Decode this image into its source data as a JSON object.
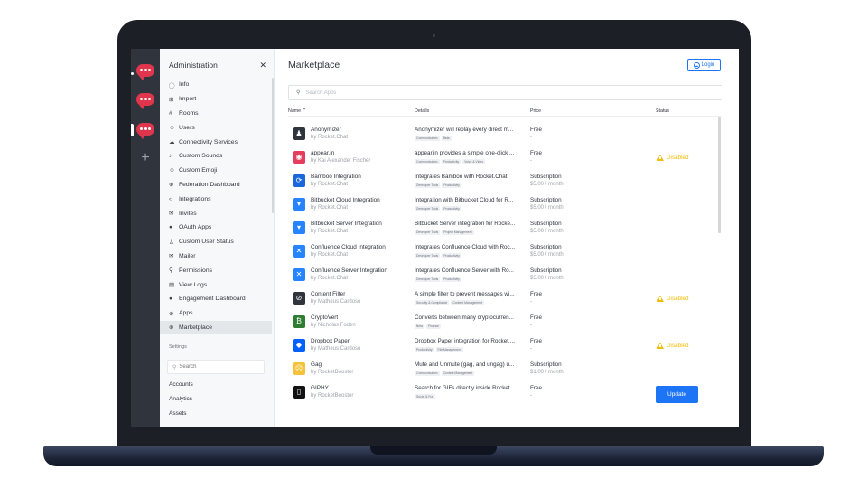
{
  "colors": {
    "accent": "#1d74f5",
    "server": "#e0364d",
    "warning": "#f3be08",
    "rail": "#2f343d",
    "bezel": "#1c1f26"
  },
  "rail": {
    "add_icon": "+"
  },
  "sidebar": {
    "title": "Administration",
    "close": "✕",
    "items": [
      {
        "icon": "ⓘ",
        "label": "Info"
      },
      {
        "icon": "⊞",
        "label": "Import"
      },
      {
        "icon": "#",
        "label": "Rooms"
      },
      {
        "icon": "☺",
        "label": "Users"
      },
      {
        "icon": "☁",
        "label": "Connectivity Services"
      },
      {
        "icon": "♪",
        "label": "Custom Sounds"
      },
      {
        "icon": "☺",
        "label": "Custom Emoji"
      },
      {
        "icon": "⊕",
        "label": "Federation Dashboard"
      },
      {
        "icon": "‹›",
        "label": "Integrations"
      },
      {
        "icon": "✉",
        "label": "Invites"
      },
      {
        "icon": "●",
        "label": "OAuth Apps"
      },
      {
        "icon": "♙",
        "label": "Custom User Status"
      },
      {
        "icon": "✉",
        "label": "Mailer"
      },
      {
        "icon": "⚲",
        "label": "Permissions"
      },
      {
        "icon": "▤",
        "label": "View Logs"
      },
      {
        "icon": "●",
        "label": "Engagement Dashboard"
      },
      {
        "icon": "⊕",
        "label": "Apps"
      },
      {
        "icon": "⊕",
        "label": "Marketplace"
      }
    ],
    "settings_label": "Settings",
    "search_icon": "⚲",
    "search_placeholder": "Search",
    "settings_items": [
      "Accounts",
      "Analytics",
      "Assets"
    ]
  },
  "main": {
    "title": "Marketplace",
    "login_label": "Login",
    "search_placeholder": "Search Apps",
    "columns": {
      "name": "Name",
      "sort_icon": "⌃",
      "details": "Details",
      "price": "Price",
      "status": "Status"
    },
    "apps": [
      {
        "name": "Anonymizer",
        "author": "by Rocket.Chat",
        "detail": "Anonymizer will replay every direct m...",
        "tags": [
          "Communication",
          "Beta"
        ],
        "price": "Free",
        "price_sub": "-",
        "status": "",
        "icon": "anonymizer-icon",
        "color": "#2f343d"
      },
      {
        "name": "appear.in",
        "author": "by Kai Alexander Fischer",
        "detail": "appear.in provides a simple one-click ...",
        "tags": [
          "Communication",
          "Productivity",
          "Voice & Video"
        ],
        "price": "Free",
        "price_sub": "-",
        "status": "Disabled",
        "icon": "appear-in-icon",
        "color": "#e53e5c"
      },
      {
        "name": "Bamboo Integration",
        "author": "by Rocket.Chat",
        "detail": "Integrates Bamboo with Rocket.Chat",
        "tags": [
          "Developer Tools",
          "Productivity"
        ],
        "price": "Subscription",
        "price_sub": "$5.00 / month",
        "status": "",
        "icon": "bamboo-icon",
        "color": "#1868db"
      },
      {
        "name": "Bitbucket Cloud Integration",
        "author": "by Rocket.Chat",
        "detail": "Integration with Bitbucket Cloud for R...",
        "tags": [
          "Developer Tools",
          "Productivity"
        ],
        "price": "Subscription",
        "price_sub": "$5.00 / month",
        "status": "",
        "icon": "bitbucket-icon",
        "color": "#2684ff"
      },
      {
        "name": "Bitbucket Server Integration",
        "author": "by Rocket.Chat",
        "detail": "Bitbucket Server integration for Rocke...",
        "tags": [
          "Developer Tools",
          "Project Management"
        ],
        "price": "Subscription",
        "price_sub": "$5.00 / month",
        "status": "",
        "icon": "bitbucket-icon",
        "color": "#2684ff"
      },
      {
        "name": "Confluence Cloud Integration",
        "author": "by Rocket.Chat",
        "detail": "Integrates Confluence Cloud with Roc...",
        "tags": [
          "Developer Tools",
          "Productivity"
        ],
        "price": "Subscription",
        "price_sub": "$5.00 / month",
        "status": "",
        "icon": "confluence-icon",
        "color": "#2684ff"
      },
      {
        "name": "Confluence Server Integration",
        "author": "by Rocket.Chat",
        "detail": "Integrates Confluence Server with Ro...",
        "tags": [
          "Developer Tools",
          "Productivity"
        ],
        "price": "Subscription",
        "price_sub": "$5.00 / month",
        "status": "",
        "icon": "confluence-icon",
        "color": "#2684ff"
      },
      {
        "name": "Content Filter",
        "author": "by Matheus Cardoso",
        "detail": "A simple filter to prevent messages wi...",
        "tags": [
          "Security & Compliance",
          "Content Management"
        ],
        "price": "Free",
        "price_sub": "-",
        "status": "Disabled",
        "icon": "content-filter-icon",
        "color": "#2f343d"
      },
      {
        "name": "CryptoVert",
        "author": "by Nicholas Foden",
        "detail": "Converts between many cryptocurren...",
        "tags": [
          "Beta",
          "Finance"
        ],
        "price": "Free",
        "price_sub": "-",
        "status": "",
        "icon": "cryptovert-icon",
        "color": "#2e7d32"
      },
      {
        "name": "Dropbox Paper",
        "author": "by Matheus Cardoso",
        "detail": "Dropbox Paper integration for Rocket....",
        "tags": [
          "Productivity",
          "File Management"
        ],
        "price": "Free",
        "price_sub": "-",
        "status": "Disabled",
        "icon": "dropbox-icon",
        "color": "#0061ff"
      },
      {
        "name": "Gag",
        "author": "by RocketBooster",
        "detail": "Mute and Unmute (gag, and ungag) u...",
        "tags": [
          "Communication",
          "Content Management"
        ],
        "price": "Subscription",
        "price_sub": "$1.00 / month",
        "status": "",
        "icon": "gag-emoji-icon",
        "color": "#f5c33b"
      },
      {
        "name": "GIPHY",
        "author": "by RocketBooster",
        "detail": "Search for GIFs directly inside Rocket....",
        "tags": [
          "Social & Fun"
        ],
        "price": "Free",
        "price_sub": "-",
        "status": "update",
        "icon": "giphy-icon",
        "color": "#121212"
      }
    ],
    "update_label": "Update"
  }
}
